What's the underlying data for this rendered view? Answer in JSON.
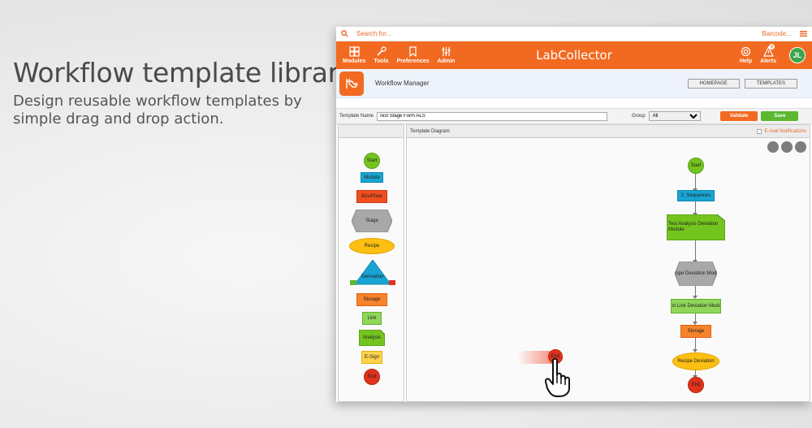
{
  "headline": "Workflow template library",
  "subline": "Design reusable workflow templates by simple drag and drop action.",
  "app": {
    "search_placeholder": "Search for...",
    "barcode_label": "Barcode...",
    "nav": [
      {
        "label": "Modules",
        "icon": "modules-icon"
      },
      {
        "label": "Tools",
        "icon": "tools-icon"
      },
      {
        "label": "Preferences",
        "icon": "bookmark-icon"
      },
      {
        "label": "Admin",
        "icon": "sliders-icon"
      }
    ],
    "logo_text": "LabCollector",
    "help_label": "Help",
    "alerts_label": "Alerts",
    "alerts_count": "0",
    "avatar_initials": "JL",
    "page_title": "Workflow Manager",
    "homepage_button": "HOMEPAGE",
    "templates_button": "TEMPLATES",
    "template_name_label": "Template Name",
    "template_name_value": "Test Stage Form ALS",
    "group_label": "Group",
    "group_value": "All",
    "validate_button": "Validate",
    "save_button": "Save",
    "diagram_title": "Template Diagram",
    "email_notifications_label": "E-mail Notifications",
    "palette": {
      "start": "Start",
      "module": "Module",
      "box_plate": "Box/Plate",
      "stage": "Stage",
      "recipe": "Recipe",
      "derivation": "Derivation",
      "storage": "Storage",
      "link": "Link",
      "analysis": "Analysis",
      "esign": "E-Sign",
      "end": "End"
    },
    "flow": {
      "start": "Start",
      "sequences": "2. Sequences",
      "analysis": "Test Analysis Deviation Module",
      "stage": "Recipe Deviation Module",
      "link": "Test Link Deviation Module",
      "storage": "Storage",
      "recipe": "Recipe Deviation",
      "end": "End"
    },
    "dragged_end": "End"
  }
}
